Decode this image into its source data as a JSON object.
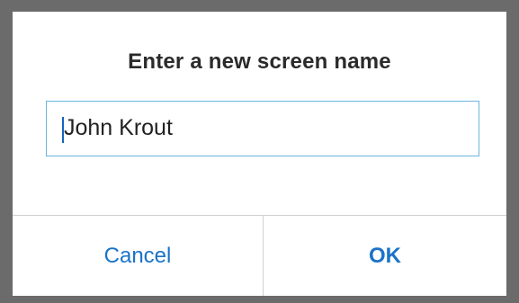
{
  "dialog": {
    "title": "Enter a new screen name",
    "input": {
      "value": "John Krout"
    },
    "buttons": {
      "cancel_label": "Cancel",
      "ok_label": "OK"
    },
    "colors": {
      "accent": "#1a73c8",
      "input_border": "#6cb4dd",
      "frame": "#6b6b6b"
    }
  }
}
